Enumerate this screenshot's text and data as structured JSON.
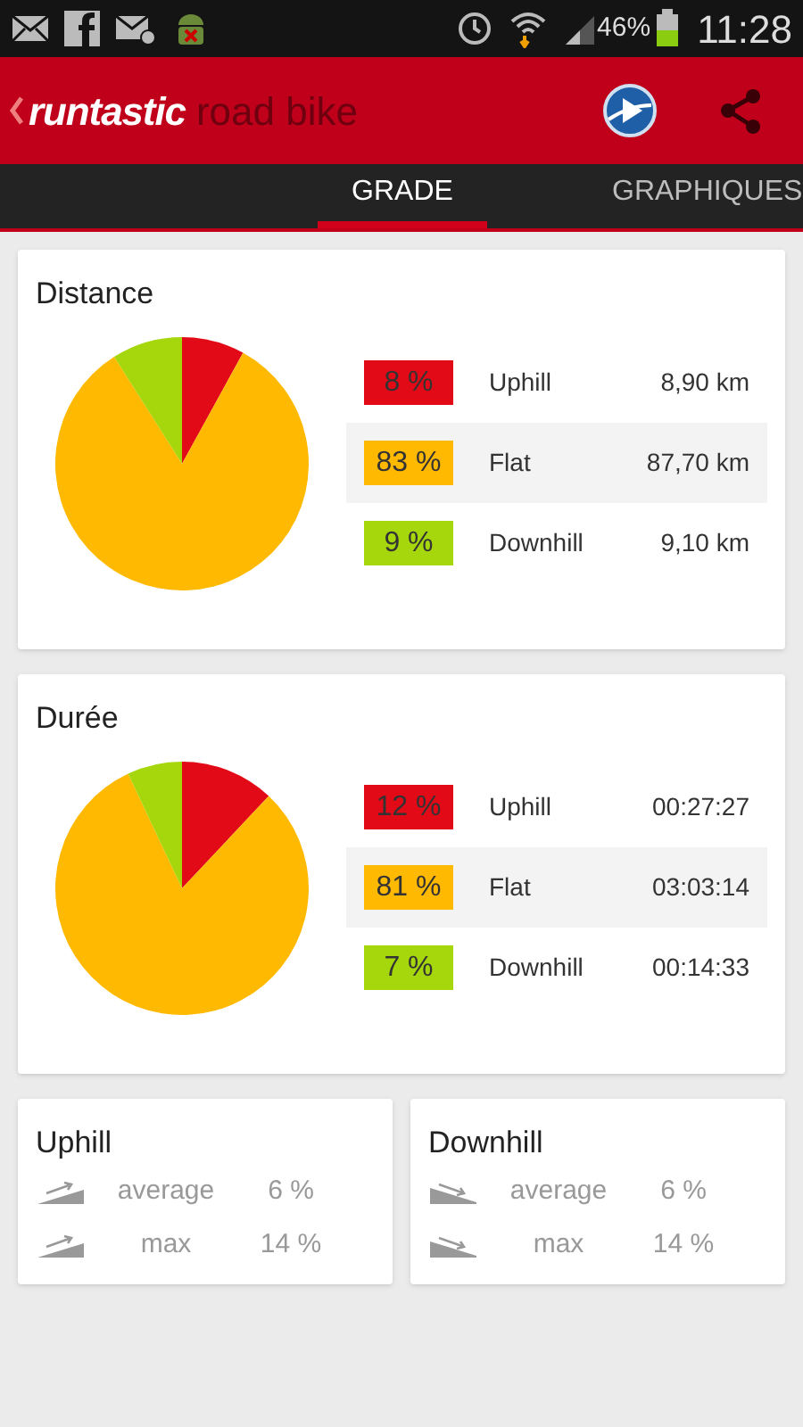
{
  "status_bar": {
    "battery": "46%",
    "time": "11:28"
  },
  "app_bar": {
    "brand": "runtastic",
    "product": "road bike"
  },
  "tabs": [
    {
      "label": "GRADE",
      "selected": true
    },
    {
      "label": "GRAPHIQUES",
      "selected": false
    }
  ],
  "sections": [
    {
      "title": "Distance",
      "chart_data": {
        "type": "pie",
        "series": [
          {
            "values": [
              8,
              83,
              9
            ]
          }
        ]
      },
      "rows": [
        {
          "percent": "8 %",
          "label": "Uphill",
          "value": "8,90 km",
          "color": "#e30a17",
          "selected": false
        },
        {
          "percent": "83 %",
          "label": "Flat",
          "value": "87,70 km",
          "color": "#ffb900",
          "selected": true
        },
        {
          "percent": "9 %",
          "label": "Downhill",
          "value": "9,10 km",
          "color": "#a6d60c",
          "selected": false
        }
      ]
    },
    {
      "title": "Durée",
      "chart_data": {
        "type": "pie",
        "series": [
          {
            "values": [
              12,
              81,
              7
            ]
          }
        ]
      },
      "rows": [
        {
          "percent": "12 %",
          "label": "Uphill",
          "value": "00:27:27",
          "color": "#e30a17",
          "selected": false
        },
        {
          "percent": "81 %",
          "label": "Flat",
          "value": "03:03:14",
          "color": "#ffb900",
          "selected": true
        },
        {
          "percent": "7 %",
          "label": "Downhill",
          "value": "00:14:33",
          "color": "#a6d60c",
          "selected": false
        }
      ]
    }
  ],
  "slopes": [
    {
      "title": "Uphill",
      "kind": "uphill",
      "rows": [
        {
          "label": "average",
          "value": "6 %"
        },
        {
          "label": "max",
          "value": "14 %"
        }
      ]
    },
    {
      "title": "Downhill",
      "kind": "downhill",
      "rows": [
        {
          "label": "average",
          "value": "6 %"
        },
        {
          "label": "max",
          "value": "14 %"
        }
      ]
    }
  ]
}
